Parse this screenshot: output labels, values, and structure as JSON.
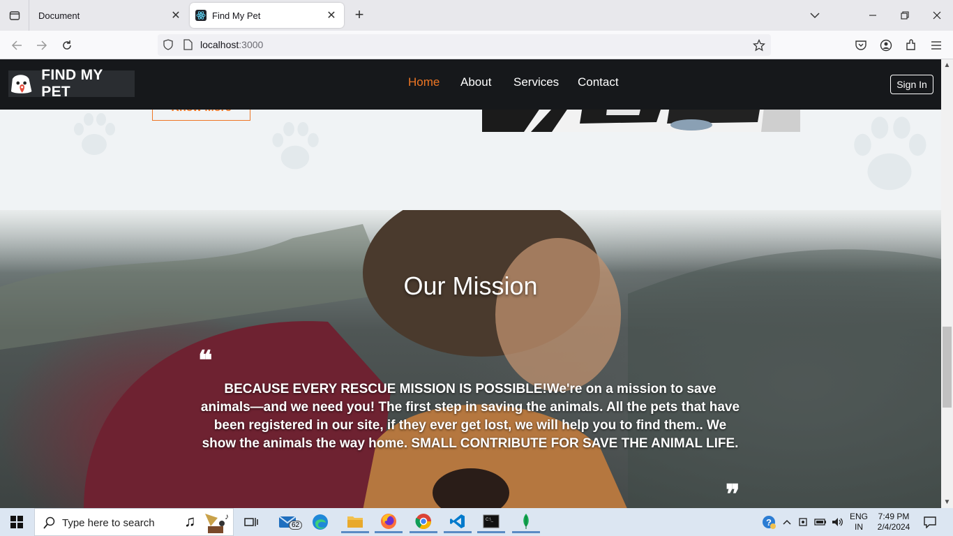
{
  "browser": {
    "tabs": [
      {
        "title": "Document",
        "active": false
      },
      {
        "title": "Find My Pet",
        "active": true
      }
    ],
    "url_host": "localhost",
    "url_port": ":3000"
  },
  "site": {
    "logo_text": "FIND MY PET",
    "nav": [
      "Home",
      "About",
      "Services",
      "Contact"
    ],
    "signin_label": "Sign In",
    "know_more_label": "Know More"
  },
  "mission": {
    "title": "Our Mission",
    "text": "BECAUSE EVERY RESCUE MISSION IS POSSIBLE!We're on a mission to save animals—and we need you! The first step in saving the animals. All the pets that have been registered in our site, if they ever get lost, we will help you to find them.. We show the animals the way home. SMALL CONTRIBUTE FOR SAVE THE ANIMAL LIFE.",
    "open_quote": "❝",
    "close_quote": "❞"
  },
  "taskbar": {
    "search_placeholder": "Type here to search",
    "mail_badge": "62",
    "lang": "ENG",
    "region": "IN",
    "time": "7:49 PM",
    "date": "2/4/2024"
  },
  "colors": {
    "accent": "#ee7624",
    "header_bg": "#16181b"
  }
}
